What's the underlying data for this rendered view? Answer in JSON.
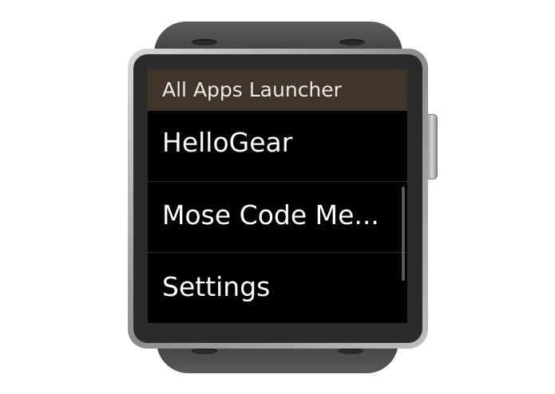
{
  "launcher": {
    "title": "All Apps Launcher",
    "items": [
      {
        "label": "HelloGear"
      },
      {
        "label": "Mose Code Me..."
      },
      {
        "label": "Settings"
      }
    ]
  },
  "colors": {
    "header_background": "#3f352b",
    "screen_background": "#000000",
    "text": "#ffffff",
    "watch_strap": "#4a4a4a",
    "watch_bezel": "#a8a8a8"
  }
}
